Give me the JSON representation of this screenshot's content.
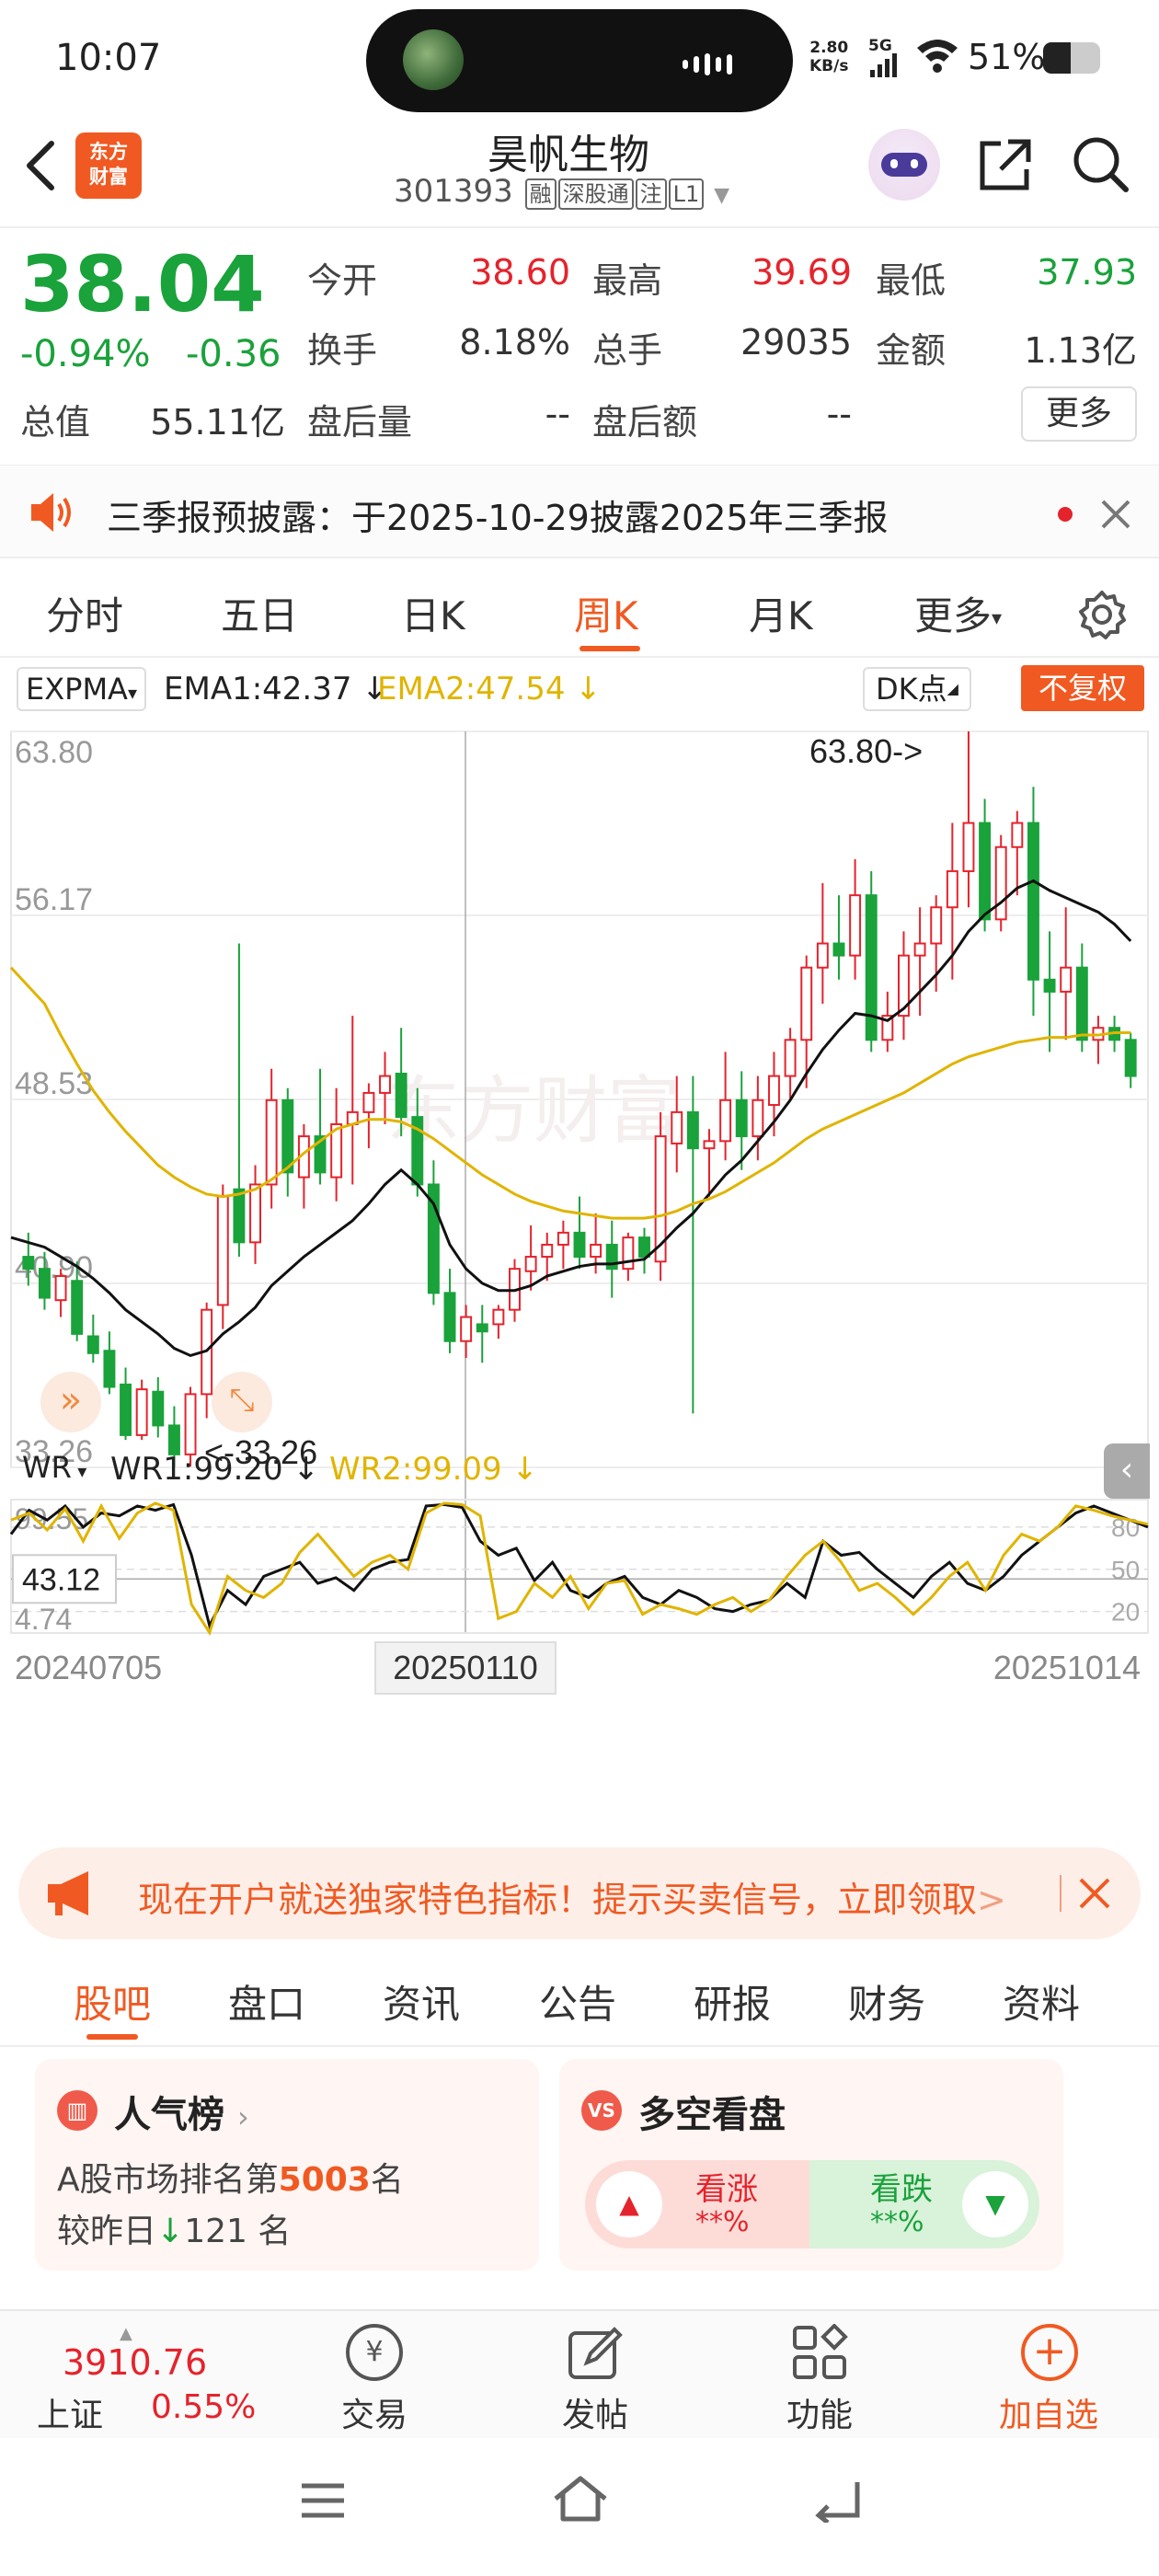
{
  "status": {
    "time": "10:07",
    "net_speed_value": "2.80",
    "net_speed_unit": "KB/s",
    "network": "5G",
    "battery": "51%"
  },
  "header": {
    "logo_line1": "东方",
    "logo_line2": "财富",
    "stock_name": "昊帆生物",
    "stock_code": "301393",
    "tags": [
      "融",
      "深股通",
      "注",
      "L1"
    ]
  },
  "quote": {
    "price": "38.04",
    "change_pct": "-0.94%",
    "change": "-0.36",
    "open_label": "今开",
    "open": "38.60",
    "high_label": "最高",
    "high": "39.69",
    "low_label": "最低",
    "low": "37.93",
    "turnover_label": "换手",
    "turnover": "8.18%",
    "volume_label": "总手",
    "volume": "29035",
    "amount_label": "金额",
    "amount": "1.13亿",
    "mktcap_label": "总值",
    "mktcap": "55.11亿",
    "after_vol_label": "盘后量",
    "after_vol": "--",
    "after_amt_label": "盘后额",
    "after_amt": "--",
    "more_label": "更多"
  },
  "notice": {
    "text": "三季报预披露：于2025-10-29披露2025年三季报"
  },
  "period_tabs": [
    "分时",
    "五日",
    "日K",
    "周K",
    "月K",
    "更多"
  ],
  "active_tab": "周K",
  "chart_header": {
    "indicator": "EXPMA",
    "ema1": "EMA1:42.37",
    "ema2": "EMA2:47.54",
    "dk": "DK点",
    "adjust": "不复权"
  },
  "chart_data": [
    {
      "type": "candlestick",
      "title": "",
      "ylim": [
        33.26,
        63.8
      ],
      "y_ticks": [
        "63.80",
        "56.17",
        "48.53",
        "40.90",
        "33.26"
      ],
      "max_label": "63.80->",
      "min_label": "<-33.26",
      "watermark": "东方财富",
      "candles": [
        [
          42.0,
          43.0,
          40.8,
          41.5
        ],
        [
          41.5,
          42.2,
          39.8,
          40.3
        ],
        [
          40.2,
          41.5,
          39.5,
          41.2
        ],
        [
          41.0,
          41.8,
          38.5,
          38.8
        ],
        [
          38.7,
          39.6,
          37.6,
          38.0
        ],
        [
          38.1,
          38.9,
          36.3,
          36.6
        ],
        [
          36.7,
          37.4,
          34.4,
          34.6
        ],
        [
          34.6,
          36.9,
          34.4,
          36.5
        ],
        [
          36.4,
          37.0,
          34.5,
          35.0
        ],
        [
          35.0,
          35.8,
          33.3,
          33.8
        ],
        [
          33.8,
          36.6,
          33.3,
          36.3
        ],
        [
          36.3,
          40.1,
          35.3,
          39.8
        ],
        [
          40.0,
          45.0,
          39.0,
          44.5
        ],
        [
          44.8,
          55.0,
          42.0,
          42.6
        ],
        [
          42.6,
          45.8,
          41.7,
          45.0
        ],
        [
          45.0,
          49.8,
          44.0,
          48.5
        ],
        [
          48.5,
          49.0,
          44.5,
          45.5
        ],
        [
          45.3,
          47.5,
          44.0,
          47.0
        ],
        [
          47.0,
          49.8,
          45.0,
          45.5
        ],
        [
          45.3,
          49.0,
          44.3,
          47.5
        ],
        [
          47.5,
          52.0,
          45.0,
          48.0
        ],
        [
          48.0,
          49.2,
          46.5,
          48.8
        ],
        [
          48.8,
          50.5,
          47.5,
          49.5
        ],
        [
          49.6,
          51.5,
          47.0,
          47.8
        ],
        [
          47.8,
          49.0,
          44.5,
          45.0
        ],
        [
          45.0,
          46.0,
          40.0,
          40.5
        ],
        [
          40.5,
          41.5,
          38.0,
          38.5
        ],
        [
          38.5,
          40.0,
          37.8,
          39.5
        ],
        [
          39.2,
          40.0,
          37.6,
          38.9
        ],
        [
          39.2,
          40.0,
          38.6,
          39.8
        ],
        [
          39.8,
          41.9,
          39.3,
          41.5
        ],
        [
          41.4,
          43.3,
          40.6,
          42.0
        ],
        [
          42.0,
          43.0,
          41.0,
          42.5
        ],
        [
          42.5,
          43.5,
          41.5,
          43.0
        ],
        [
          43.0,
          44.5,
          41.5,
          42.0
        ],
        [
          42.0,
          43.8,
          41.3,
          42.5
        ],
        [
          42.5,
          43.5,
          40.3,
          41.5
        ],
        [
          41.5,
          43.0,
          41.0,
          42.8
        ],
        [
          42.8,
          43.2,
          41.3,
          42.0
        ],
        [
          41.8,
          48.0,
          41.0,
          47.0
        ],
        [
          46.7,
          49.5,
          45.5,
          48.0
        ],
        [
          48.0,
          49.5,
          35.5,
          46.5
        ],
        [
          46.5,
          47.3,
          44.5,
          46.8
        ],
        [
          46.8,
          50.5,
          46.0,
          48.5
        ],
        [
          48.5,
          49.7,
          45.6,
          47.0
        ],
        [
          47.0,
          49.5,
          46.0,
          48.5
        ],
        [
          48.3,
          50.5,
          47.0,
          49.5
        ],
        [
          49.5,
          51.5,
          48.5,
          51.0
        ],
        [
          51.0,
          54.5,
          49.0,
          54.0
        ],
        [
          54.0,
          57.5,
          52.5,
          55.0
        ],
        [
          55.0,
          57.0,
          53.5,
          54.5
        ],
        [
          54.5,
          58.5,
          53.5,
          57.0
        ],
        [
          57.0,
          58.0,
          50.5,
          51.0
        ],
        [
          51.0,
          53.0,
          50.5,
          52.0
        ],
        [
          52.0,
          55.5,
          51.0,
          54.5
        ],
        [
          54.5,
          56.5,
          52.0,
          55.0
        ],
        [
          55.0,
          57.0,
          53.0,
          56.5
        ],
        [
          56.5,
          60.0,
          53.5,
          58.0
        ],
        [
          58.0,
          63.8,
          56.5,
          60.0
        ],
        [
          60.0,
          61.0,
          55.5,
          56.0
        ],
        [
          56.0,
          59.5,
          55.5,
          59.0
        ],
        [
          59.0,
          60.5,
          57.0,
          60.0
        ],
        [
          60.0,
          61.5,
          52.0,
          53.5
        ],
        [
          53.5,
          55.5,
          50.5,
          53.0
        ],
        [
          53.0,
          56.5,
          51.0,
          54.0
        ],
        [
          54.0,
          55.0,
          50.5,
          51.0
        ],
        [
          51.0,
          52.0,
          50.0,
          51.5
        ],
        [
          51.5,
          52.0,
          50.5,
          51.0
        ],
        [
          51.0,
          51.3,
          49.0,
          49.5
        ]
      ],
      "ema1": [
        42.8,
        42.4,
        42.0,
        41.6,
        41.1,
        40.5,
        39.8,
        39.3,
        38.8,
        38.2,
        37.9,
        38.1,
        38.8,
        39.3,
        39.9,
        40.8,
        41.4,
        42.0,
        42.5,
        43.0,
        43.5,
        44.2,
        45.0,
        45.6,
        45.0,
        44.2,
        42.5,
        41.5,
        40.9,
        40.6,
        40.6,
        40.8,
        41.2,
        41.4,
        41.6,
        41.7,
        41.7,
        41.8,
        41.9,
        42.5,
        43.2,
        43.8,
        44.6,
        45.4,
        46.0,
        46.8,
        47.6,
        48.5,
        49.6,
        50.6,
        51.4,
        52.1,
        52.0,
        51.8,
        52.3,
        53.0,
        53.7,
        54.5,
        55.5,
        56.2,
        56.7,
        57.3,
        57.6,
        57.2,
        56.9,
        56.6,
        56.3,
        55.8,
        55.1
      ],
      "ema2": [
        54.0,
        52.5,
        51.2,
        50.0,
        48.9,
        48.0,
        47.2,
        46.5,
        45.8,
        45.3,
        44.9,
        44.6,
        44.5,
        44.6,
        44.8,
        45.2,
        45.7,
        46.3,
        46.8,
        47.3,
        47.5,
        47.7,
        47.7,
        47.6,
        47.3,
        46.9,
        46.4,
        45.9,
        45.4,
        45.0,
        44.6,
        44.3,
        44.1,
        43.9,
        43.8,
        43.7,
        43.6,
        43.6,
        43.6,
        43.7,
        43.9,
        44.2,
        44.4,
        44.7,
        45.1,
        45.5,
        45.9,
        46.4,
        46.9,
        47.3,
        47.6,
        47.9,
        48.2,
        48.5,
        48.8,
        49.2,
        49.6,
        50.0,
        50.3,
        50.5,
        50.7,
        50.9,
        51.0,
        51.1,
        51.1,
        51.2,
        51.2,
        51.3,
        51.3
      ]
    },
    {
      "type": "line",
      "title": "",
      "ylim": [
        4.74,
        99.55
      ],
      "y_ticks": [
        "99.55",
        "43.12",
        "4.74"
      ],
      "ref_ticks": [
        "80",
        "50",
        "20"
      ],
      "series": [
        {
          "name": "WR1:99.20",
          "values": [
            75,
            92,
            85,
            95,
            80,
            90,
            88,
            95,
            92,
            96,
            60,
            10,
            35,
            25,
            45,
            50,
            55,
            40,
            44,
            35,
            50,
            55,
            57,
            95,
            96,
            94,
            70,
            60,
            65,
            42,
            55,
            35,
            30,
            40,
            45,
            30,
            25,
            35,
            30,
            22,
            20,
            25,
            28,
            40,
            30,
            70,
            60,
            62,
            50,
            40,
            30,
            45,
            55,
            40,
            35,
            45,
            60,
            70,
            80,
            90,
            95,
            90,
            85,
            80
          ],
          "color": "#111111"
        },
        {
          "name": "WR2:99.09",
          "values": [
            85,
            90,
            78,
            93,
            70,
            95,
            72,
            90,
            97,
            92,
            25,
            5,
            45,
            35,
            30,
            40,
            62,
            75,
            60,
            45,
            55,
            60,
            50,
            90,
            97,
            96,
            88,
            15,
            20,
            40,
            30,
            45,
            22,
            40,
            42,
            18,
            25,
            22,
            18,
            25,
            30,
            20,
            28,
            45,
            60,
            70,
            55,
            35,
            40,
            30,
            18,
            30,
            45,
            55,
            35,
            60,
            75,
            70,
            80,
            95,
            92,
            88,
            85,
            82
          ],
          "color": "#e0b400"
        }
      ],
      "x_ticks": [
        "20240705",
        "20250110",
        "20251014"
      ],
      "crosshair_value": "43.12",
      "crosshair_date": "20250110"
    }
  ],
  "wr_header": {
    "indicator": "WR",
    "wr1": "WR1:99.20",
    "wr2": "WR2:99.09"
  },
  "ad": {
    "text": "现在开户就送独家特色指标！提示买卖信号，立即领取"
  },
  "bottom_tabs": [
    "股吧",
    "盘口",
    "资讯",
    "公告",
    "研报",
    "财务",
    "资料"
  ],
  "active_bottom_tab": "股吧",
  "popularity": {
    "title": "人气榜",
    "rank_prefix": "A股市场排名第",
    "rank": "5003",
    "rank_suffix": "名",
    "change_prefix": "较昨日",
    "change": "121",
    "change_suffix": "名"
  },
  "bullbear": {
    "title": "多空看盘",
    "up_label": "看涨",
    "up_value": "**%",
    "down_label": "看跌",
    "down_value": "**%"
  },
  "bottom_nav": {
    "index_value": "3910.76",
    "index_name": "上证",
    "index_change": "0.55%",
    "trade": "交易",
    "post": "发帖",
    "functions": "功能",
    "add_watch": "加自选"
  }
}
